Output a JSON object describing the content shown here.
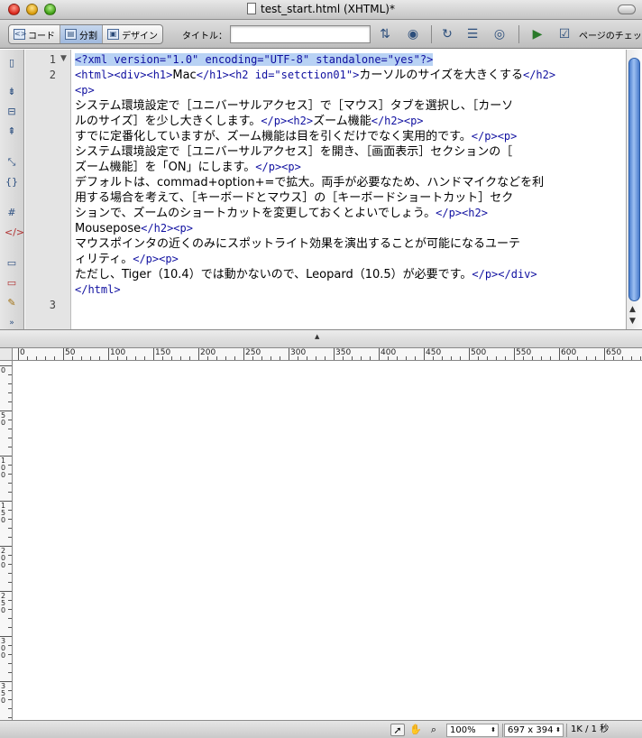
{
  "window": {
    "title": "test_start.html (XHTML)*"
  },
  "toolbar": {
    "view_code": "コード",
    "view_split": "分割",
    "view_design": "デザイン",
    "title_label": "タイトル：",
    "title_value": "",
    "preview_label": "ページのチェック"
  },
  "editor": {
    "line_numbers": [
      "1",
      "2",
      "3"
    ],
    "lines": [
      [
        {
          "t": "tag",
          "v": "<?xml version=\"1.0\" encoding=\"UTF-8\" standalone=\"yes\"?>"
        }
      ],
      [
        {
          "t": "tag",
          "v": "<html><div><h1>"
        },
        {
          "t": "txt",
          "v": "Mac"
        },
        {
          "t": "tag",
          "v": "</h1><h2 id=\"setction01\">"
        },
        {
          "t": "txt",
          "v": "カーソルのサイズを大きくする"
        },
        {
          "t": "tag",
          "v": "</h2>"
        }
      ],
      [
        {
          "t": "tag",
          "v": "<p>"
        }
      ],
      [
        {
          "t": "txt",
          "v": "システム環境設定で［ユニバーサルアクセス］で［マウス］タブを選択し、［カーソ"
        }
      ],
      [
        {
          "t": "txt",
          "v": "ルのサイズ］を少し大きくします。"
        },
        {
          "t": "tag",
          "v": "</p><h2>"
        },
        {
          "t": "txt",
          "v": "ズーム機能"
        },
        {
          "t": "tag",
          "v": "</h2><p>"
        }
      ],
      [
        {
          "t": "txt",
          "v": "すでに定番化していますが、ズーム機能は目を引くだけでなく実用的です。"
        },
        {
          "t": "tag",
          "v": "</p><p>"
        }
      ],
      [
        {
          "t": "txt",
          "v": "システム環境設定で［ユニバーサルアクセス］を開き、［画面表示］セクションの［"
        }
      ],
      [
        {
          "t": "txt",
          "v": "ズーム機能］を「ON」にします。"
        },
        {
          "t": "tag",
          "v": "</p><p>"
        }
      ],
      [
        {
          "t": "txt",
          "v": "デフォルトは、commad+option+=で拡大。両手が必要なため、ハンドマイクなどを利"
        }
      ],
      [
        {
          "t": "txt",
          "v": "用する場合を考えて、［キーボードとマウス］の［キーボードショートカット］セク"
        }
      ],
      [
        {
          "t": "txt",
          "v": "ションで、ズームのショートカットを変更しておくとよいでしょう。"
        },
        {
          "t": "tag",
          "v": "</p><h2>"
        }
      ],
      [
        {
          "t": "txt",
          "v": "Mousepose"
        },
        {
          "t": "tag",
          "v": "</h2><p>"
        }
      ],
      [
        {
          "t": "txt",
          "v": "マウスポインタの近くのみにスポットライト効果を演出することが可能になるユーテ"
        }
      ],
      [
        {
          "t": "txt",
          "v": "ィリティ。"
        },
        {
          "t": "tag",
          "v": "</p><p>"
        }
      ],
      [
        {
          "t": "txt",
          "v": "ただし、Tiger（10.4）では動かないので、Leopard（10.5）が必要です。"
        },
        {
          "t": "tag",
          "v": "</p></div>"
        }
      ],
      [
        {
          "t": "tag",
          "v": "</html>"
        }
      ],
      [],
      []
    ]
  },
  "ruler": {
    "h_labels": [
      "0",
      "50",
      "100",
      "150",
      "200",
      "250",
      "300",
      "350",
      "400",
      "450",
      "500",
      "550",
      "600",
      "650"
    ],
    "v_labels": [
      "0",
      "50",
      "100",
      "150",
      "200",
      "250",
      "300",
      "350"
    ]
  },
  "status": {
    "zoom": "100%",
    "dimensions": "697 x 394",
    "file_info": "1K / 1 秒"
  },
  "colors": {
    "tag": "#1010a0",
    "selection": "#b8d2f4",
    "scroll_thumb": "#4c7fd0"
  }
}
